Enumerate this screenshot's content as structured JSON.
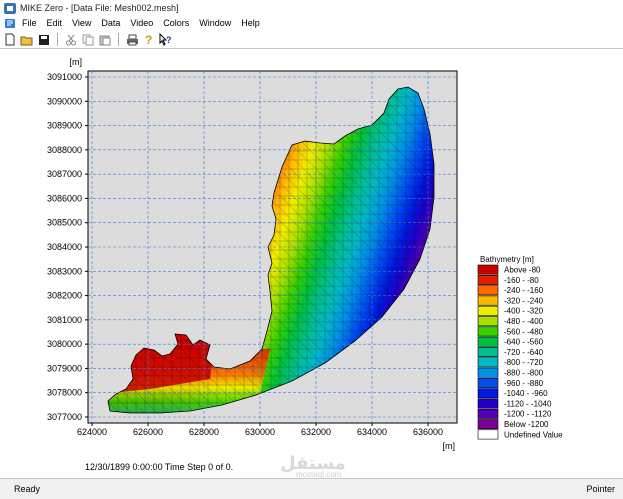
{
  "window": {
    "title": "MIKE Zero - [Data File: Mesh002.mesh]"
  },
  "menu": [
    "File",
    "Edit",
    "View",
    "Data",
    "Video",
    "Colors",
    "Window",
    "Help"
  ],
  "toolbar": {
    "icons": [
      "new-icon",
      "open-icon",
      "save-icon",
      "cut-icon",
      "copy-icon",
      "paste-icon",
      "print-icon",
      "help-icon",
      "context-help-icon"
    ]
  },
  "plot": {
    "y_unit": "[m]",
    "x_unit": "[m]",
    "y_ticks": [
      "3091000",
      "3090000",
      "3089000",
      "3088000",
      "3087000",
      "3086000",
      "3085000",
      "3084000",
      "3083000",
      "3082000",
      "3081000",
      "3080000",
      "3079000",
      "3078000",
      "3077000"
    ],
    "x_ticks": [
      "624000",
      "626000",
      "628000",
      "630000",
      "632000",
      "634000",
      "636000"
    ],
    "time_label": "12/30/1899 0:00:00  Time Step 0 of 0."
  },
  "legend": {
    "title": "Bathymetry [m]",
    "items": [
      {
        "label": "Above    -80",
        "color": "#c80000"
      },
      {
        "label": "-160 -   -80",
        "color": "#e02000"
      },
      {
        "label": "-240 - -160",
        "color": "#ff6a00"
      },
      {
        "label": "-320 - -240",
        "color": "#ffb800"
      },
      {
        "label": "-400 - -320",
        "color": "#f0ee00"
      },
      {
        "label": "-480 - -400",
        "color": "#a8e000"
      },
      {
        "label": "-560 - -480",
        "color": "#38d000"
      },
      {
        "label": "-640 - -560",
        "color": "#00c040"
      },
      {
        "label": "-720 - -640",
        "color": "#00c090"
      },
      {
        "label": "-800 - -720",
        "color": "#00b8c8"
      },
      {
        "label": "-880 - -800",
        "color": "#0090e8"
      },
      {
        "label": "-960 - -880",
        "color": "#0050f0"
      },
      {
        "label": "-1040 - -960",
        "color": "#0018e0"
      },
      {
        "label": "-1120 - -1040",
        "color": "#2000c8"
      },
      {
        "label": "-1200 - -1120",
        "color": "#5000b0"
      },
      {
        "label": "Below  -1200",
        "color": "#7a0098"
      },
      {
        "label": "Undefined Value",
        "color": "#ffffff"
      }
    ]
  },
  "status": {
    "left": "Ready",
    "right": "Pointer"
  },
  "watermark": {
    "arabic": "مستقل",
    "latin": "mostaql.com"
  }
}
